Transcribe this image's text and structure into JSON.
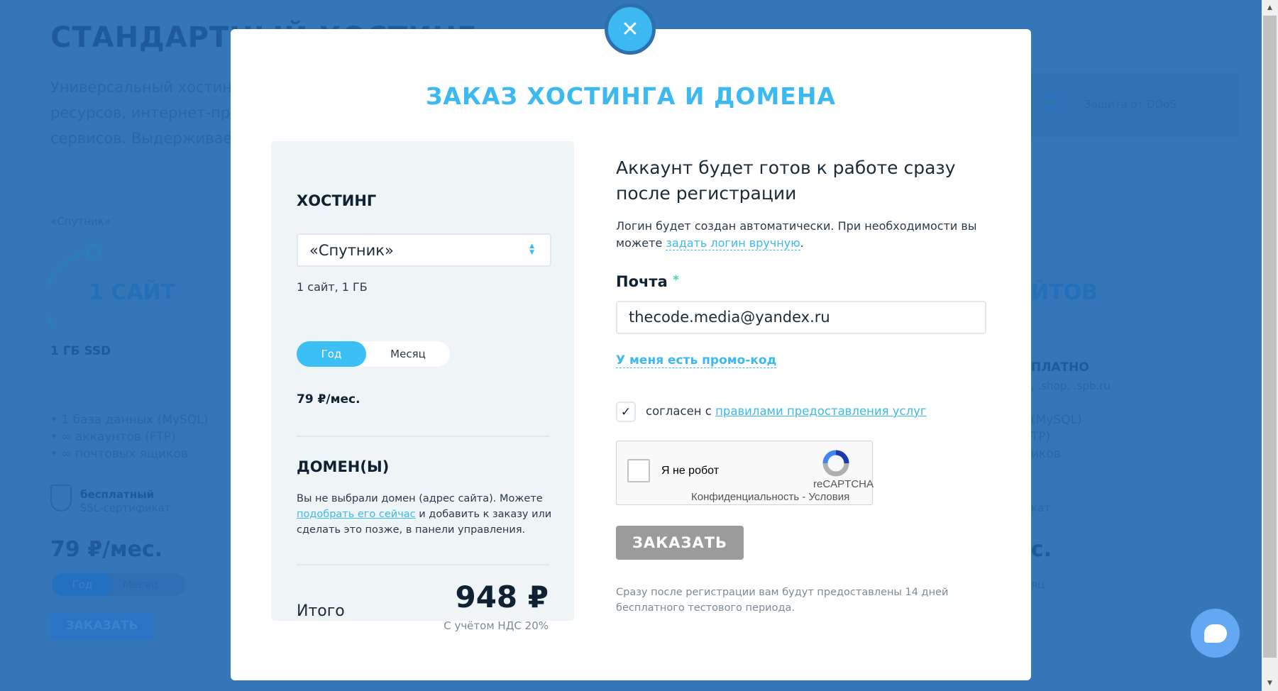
{
  "background": {
    "title": "СТАНДАРТНЫЙ ХОСТИНГ",
    "desc": [
      "Универсальный хостинг",
      "ресурсов, интернет-пре",
      "сервисов. Выдерживае"
    ],
    "plan_name": "«Спутник»",
    "plan_sites": "1 САЙТ",
    "plan_disk": "1 ГБ SSD",
    "features": [
      "1 база данных (MySQL)",
      "∞ аккаунтов (FTP)",
      "∞ почтовых ящиков"
    ],
    "ssl_bold": "бесплатный",
    "ssl": "SSL-сертификат",
    "price": "79 ₽/мес.",
    "toggle_year": "Год",
    "toggle_month": "Месяц",
    "order": "ЗАКАЗАТЬ",
    "ddos": "Защита от DDoS",
    "right_sites": "ЙТОВ",
    "right_free": "ПЛАТНО",
    "right_domains": ", .shop, .spb.ru",
    "right_features": [
      "(MySQL)",
      "TP)",
      "иков"
    ],
    "right_ssl": "кат",
    "right_price": "с.",
    "right_month": "яц"
  },
  "modal": {
    "title": "ЗАКАЗ ХОСТИНГА И ДОМЕНА",
    "hosting": {
      "heading": "ХОСТИНГ",
      "plan_select": "«Спутник»",
      "plan_desc": "1 сайт, 1 ГБ",
      "period_options": [
        "Год",
        "Месяц"
      ],
      "period_selected": "Год",
      "price": "79 ₽/мес."
    },
    "domain": {
      "heading": "ДОМЕН(Ы)",
      "text_before": "Вы не выбрали домен (адрес сайта). Можете",
      "link": "подобрать его сейчас",
      "text_after": "и добавить к заказу или сделать это позже, в панели управления."
    },
    "total": {
      "label": "Итого",
      "amount": "948 ₽",
      "vat": "С учётом НДС 20%"
    },
    "account": {
      "heading": "Аккаунт будет готов к работе сразу после регистрации",
      "login_text": "Логин будет создан автоматически. При необходимости вы можете",
      "login_link": "задать логин вручную",
      "login_end": "."
    },
    "email": {
      "label": "Почта",
      "required": "*",
      "value": "thecode.media@yandex.ru"
    },
    "promo_link": "У меня есть промо-код",
    "agree": {
      "checked": true,
      "text": "согласен с",
      "link": "правилами предоставления услуг"
    },
    "recaptcha": {
      "label": "Я не робот",
      "brand": "reCAPTCHA",
      "links": "Конфиденциальность - Условия"
    },
    "order_button": "ЗАКАЗАТЬ",
    "trial_note": "Сразу после регистрации вам будут предоставлены 14 дней бесплатного тестового периода."
  },
  "colors": {
    "accent": "#3bb9f0",
    "overlay": "#3476b8",
    "button_disabled": "#9b9b9b",
    "required": "#3ddc97"
  }
}
